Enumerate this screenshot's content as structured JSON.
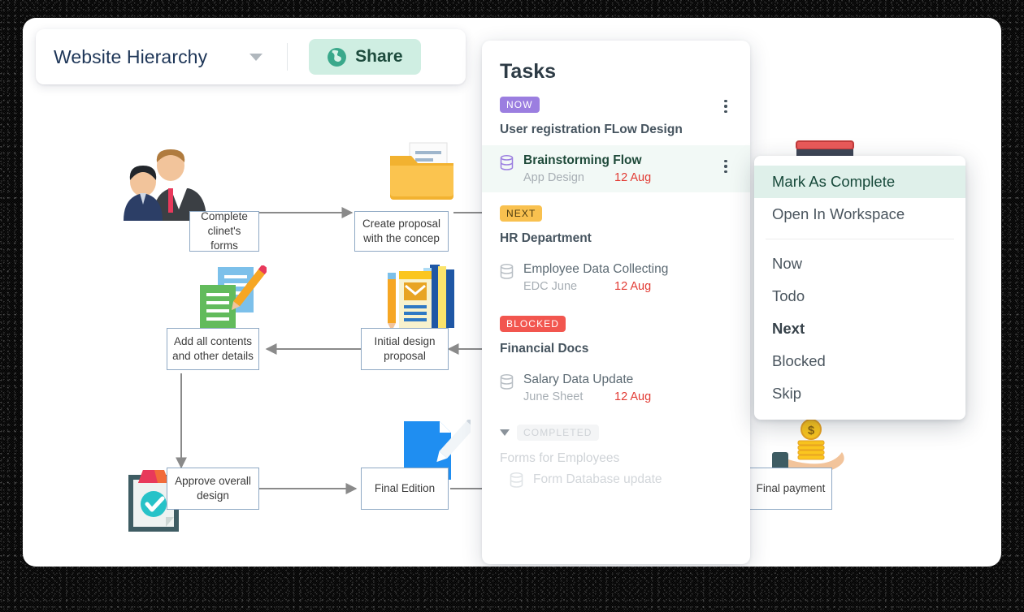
{
  "header": {
    "doc_title": "Website Hierarchy",
    "caret_icon": "chevron-down-icon",
    "share_label": "Share",
    "share_icon": "globe-icon",
    "share_bg": "#cfeee2"
  },
  "flowchart": {
    "nodes": [
      {
        "id": "complete-clients-forms",
        "line1": "Complete",
        "line2": "clinet's forms"
      },
      {
        "id": "create-proposal",
        "line1": "Create proposal",
        "line2": "with the concep"
      },
      {
        "id": "add-all-contents",
        "line1": "Add all contents",
        "line2": "and other details"
      },
      {
        "id": "initial-design-proposal",
        "line1": "Initial design",
        "line2": "proposal"
      },
      {
        "id": "approve-overall-design",
        "line1": "Approve overall",
        "line2": "design"
      },
      {
        "id": "final-edition",
        "line1": "Final Edition",
        "line2": ""
      },
      {
        "id": "final-payment",
        "line1": "Final  payment",
        "line2": ""
      }
    ],
    "node_border": "#8fa9c4",
    "connector_color": "#8a8a8a"
  },
  "tasks": {
    "title": "Tasks",
    "sections": [
      {
        "badge": "NOW",
        "badge_style": "now",
        "group": "User registration FLow Design",
        "items": [
          {
            "name": "Brainstorming Flow",
            "sub": "App Design",
            "due": "12 Aug",
            "active": true,
            "icon": "database-icon"
          }
        ]
      },
      {
        "badge": "NEXT",
        "badge_style": "next",
        "group": "HR Department",
        "items": [
          {
            "name": "Employee Data Collecting",
            "sub": "EDC June",
            "due": "12 Aug",
            "active": false,
            "icon": "database-icon"
          }
        ]
      },
      {
        "badge": "BLOCKED",
        "badge_style": "blocked",
        "group": "Financial Docs",
        "items": [
          {
            "name": "Salary Data Update",
            "sub": "June Sheet",
            "due": "12 Aug",
            "active": false,
            "icon": "database-icon"
          }
        ]
      }
    ],
    "completed": {
      "badge": "COMPLETED",
      "toggle_icon": "triangle-down-icon",
      "group": "Forms for Employees",
      "items": [
        {
          "name": "Form Database update",
          "icon": "database-icon"
        }
      ]
    },
    "badge_colors": {
      "now": "#9b7ee0",
      "next": "#f9c14f",
      "blocked": "#f2564f",
      "completed": "#f4f5f6"
    },
    "due_color": "#e23b34"
  },
  "context_menu": {
    "items": [
      {
        "label": "Mark As Complete",
        "style": "highlighted"
      },
      {
        "label": "Open In Workspace",
        "style": "normal"
      },
      {
        "label": "__sep__",
        "style": "separator"
      },
      {
        "label": "Now",
        "style": "normal"
      },
      {
        "label": "Todo",
        "style": "normal"
      },
      {
        "label": "Next",
        "style": "bold"
      },
      {
        "label": "Blocked",
        "style": "normal"
      },
      {
        "label": "Skip",
        "style": "normal"
      }
    ],
    "highlight_bg": "#dff0ea"
  }
}
